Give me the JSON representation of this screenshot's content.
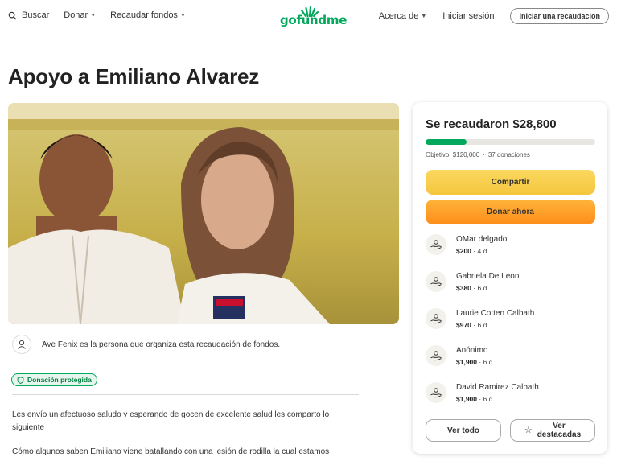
{
  "header": {
    "search_label": "Buscar",
    "donate_label": "Donar",
    "fundraise_label": "Recaudar fondos",
    "logo_text": "gofundme",
    "about_label": "Acerca de",
    "login_label": "Iniciar sesión",
    "start_label": "Iniciar una recaudación"
  },
  "campaign": {
    "title": "Apoyo a Emiliano Alvarez",
    "organizer_text": "Ave Fenix es la persona que organiza esta recaudación de fondos.",
    "protected_badge": "Donación protegida",
    "story": [
      "Les envío un afectuoso saludo y esperando de gocen de excelente salud les comparto lo siguiente",
      "Cómo algunos saben Emiliano viene batallando con una lesión de rodilla la cual estamos"
    ]
  },
  "donation_card": {
    "raised_text": "Se recaudaron $28,800",
    "progress_fraction": 0.24,
    "goal_text": "Objetivo: $120,000",
    "donations_count": "37 donaciones",
    "share_label": "Compartir",
    "donate_label": "Donar ahora",
    "donors": [
      {
        "name": "OMar delgado",
        "amount": "$200",
        "time": "4 d"
      },
      {
        "name": "Gabriela De Leon",
        "amount": "$380",
        "time": "6 d"
      },
      {
        "name": "Laurie Cotten Calbath",
        "amount": "$970",
        "time": "6 d"
      },
      {
        "name": "Anónimo",
        "amount": "$1,900",
        "time": "6 d"
      },
      {
        "name": "David Ramirez Calbath",
        "amount": "$1,900",
        "time": "6 d"
      }
    ],
    "view_all_label": "Ver todo",
    "featured_label_1": "Ver",
    "featured_label_2": "destacadas"
  },
  "colors": {
    "brand": "#02a95c",
    "share_button": "#f5c63e",
    "donate_button": "#fd8d1a"
  },
  "icons": [
    "search-icon",
    "person-icon",
    "shield-icon",
    "donation-hand-icon",
    "star-icon"
  ]
}
